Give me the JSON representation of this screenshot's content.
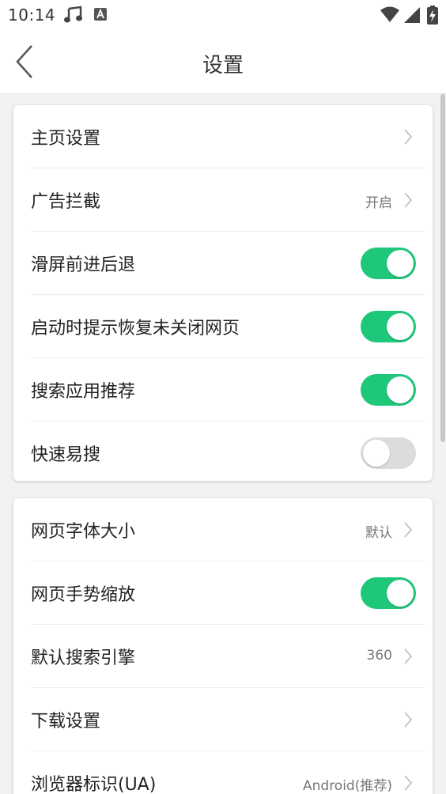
{
  "status_bar": {
    "time": "10:14",
    "icons": [
      "music-note-icon",
      "text-a-icon",
      "wifi-icon",
      "signal-icon",
      "battery-charging-icon"
    ]
  },
  "header": {
    "title": "设置",
    "back_icon": "chevron-left-icon"
  },
  "group1": {
    "home_settings": {
      "label": "主页设置"
    },
    "ad_block": {
      "label": "广告拦截",
      "value": "开启"
    },
    "swipe_nav": {
      "label": "滑屏前进后退",
      "toggle": true
    },
    "restore_tabs": {
      "label": "启动时提示恢复未关闭网页",
      "toggle": true
    },
    "app_recommend": {
      "label": "搜索应用推荐",
      "toggle": true
    },
    "quick_search": {
      "label": "快速易搜",
      "toggle": false
    }
  },
  "group2": {
    "font_size": {
      "label": "网页字体大小",
      "value": "默认"
    },
    "gesture_zoom": {
      "label": "网页手势缩放",
      "toggle": true
    },
    "search_engine": {
      "label": "默认搜索引擎",
      "value": "360"
    },
    "download_settings": {
      "label": "下载设置"
    },
    "user_agent": {
      "label": "浏览器标识(UA)",
      "value": "Android(推荐)"
    }
  },
  "colors": {
    "toggle_on": "#1fc77a",
    "toggle_off": "#dcdcdc",
    "background": "#f2f2f2"
  }
}
